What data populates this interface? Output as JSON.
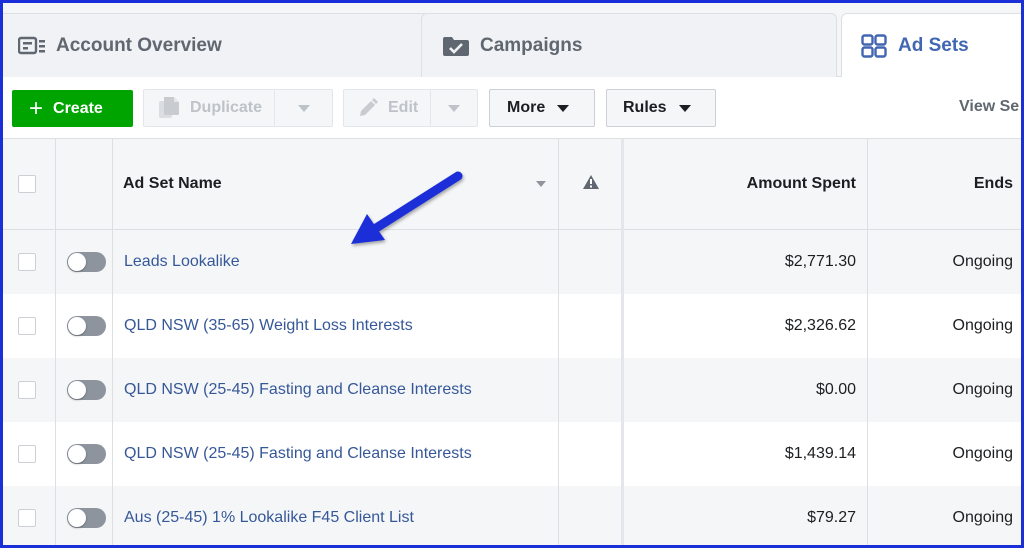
{
  "tabs": [
    {
      "label": "Account Overview",
      "icon": "account-overview-icon",
      "active": false
    },
    {
      "label": "Campaigns",
      "icon": "campaigns-folder-icon",
      "active": false
    },
    {
      "label": "Ad Sets",
      "icon": "ad-sets-grid-icon",
      "active": true
    }
  ],
  "toolbar": {
    "create_label": "Create",
    "duplicate_label": "Duplicate",
    "edit_label": "Edit",
    "more_label": "More",
    "rules_label": "Rules",
    "view_setup_label": "View Se"
  },
  "table": {
    "columns": {
      "name": "Ad Set Name",
      "warning": "warning-icon",
      "amount": "Amount Spent",
      "ends": "Ends"
    },
    "rows": [
      {
        "name": "Leads Lookalike",
        "amount": "$2,771.30",
        "ends": "Ongoing"
      },
      {
        "name": "QLD NSW (35-65) Weight Loss Interests",
        "amount": "$2,326.62",
        "ends": "Ongoing"
      },
      {
        "name": "QLD NSW (25-45) Fasting and Cleanse Interests",
        "amount": "$0.00",
        "ends": "Ongoing"
      },
      {
        "name": "QLD NSW (25-45) Fasting and Cleanse Interests",
        "amount": "$1,439.14",
        "ends": "Ongoing"
      },
      {
        "name": "Aus (25-45) 1% Lookalike F45 Client List",
        "amount": "$79.27",
        "ends": "Ongoing"
      }
    ]
  },
  "colors": {
    "accent_blue": "#4267b2",
    "link_blue": "#365899",
    "create_green": "#00a400",
    "annotation_arrow": "#1a2fd8",
    "frame_border": "#1a2fd8"
  }
}
